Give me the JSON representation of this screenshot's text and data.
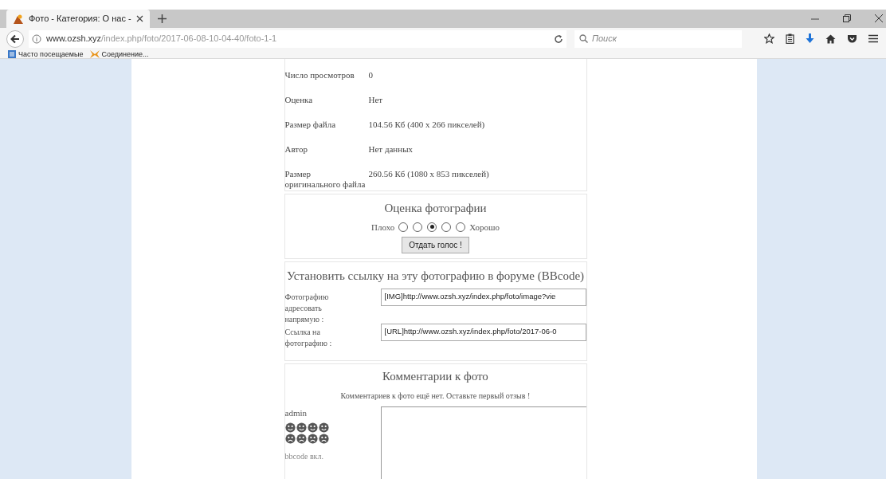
{
  "browser": {
    "tab_title": "Фото - Категория: О нас -",
    "url_domain": "www.ozsh.xyz",
    "url_path": "/index.php/foto/2017-06-08-10-04-40/foto-1-1",
    "search_placeholder": "Поиск",
    "bookmarks": [
      {
        "label": "Часто посещаемые"
      },
      {
        "label": "Соединение..."
      }
    ]
  },
  "info": [
    {
      "label": "Число просмотров",
      "value": "0"
    },
    {
      "label": "Оценка",
      "value": "Нет"
    },
    {
      "label": "Размер файла",
      "value": "104.56 Кб (400 x 266 пикселей)"
    },
    {
      "label": "Автор",
      "value": "Нет данных"
    },
    {
      "label": "Размер оригинального файла",
      "value": "260.56 Кб (1080 x 853 пикселей)"
    }
  ],
  "rating": {
    "title": "Оценка фотографии",
    "low": "Плохо",
    "high": "Хорошо",
    "options": [
      {
        "selected": false
      },
      {
        "selected": false
      },
      {
        "selected": true
      },
      {
        "selected": false
      },
      {
        "selected": false
      }
    ],
    "button": "Отдать голос !"
  },
  "bbcode": {
    "title": "Установить ссылку на эту фотографию в форуме (BBcode)",
    "fields": [
      {
        "label": "Фотографию адресовать напрямую :",
        "value": "[IMG]http://www.ozsh.xyz/index.php/foto/image?vie"
      },
      {
        "label": "Ссылка на фотографию :",
        "value": "[URL]http://www.ozsh.xyz/index.php/foto/2017-06-0"
      }
    ]
  },
  "comments": {
    "title": "Комментарии к фото",
    "empty": "Комментариев к фото ещё нет. Оставьте первый отзыв !",
    "user": "admin",
    "bbcode_status": "bbcode вкл."
  }
}
